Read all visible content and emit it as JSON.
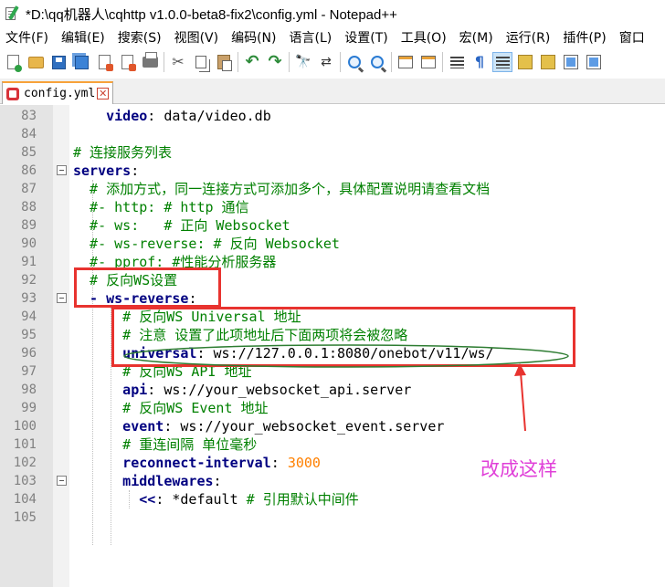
{
  "window": {
    "title": "*D:\\qq机器人\\cqhttp v1.0.0-beta8-fix2\\config.yml - Notepad++"
  },
  "menu": [
    "文件(F)",
    "编辑(E)",
    "搜索(S)",
    "视图(V)",
    "编码(N)",
    "语言(L)",
    "设置(T)",
    "工具(O)",
    "宏(M)",
    "运行(R)",
    "插件(P)",
    "窗口"
  ],
  "toolbar": {
    "icons": [
      "new-file",
      "open-file",
      "save",
      "save-all",
      "close",
      "close-all",
      "print",
      "cut",
      "copy",
      "paste",
      "undo",
      "redo",
      "find",
      "replace",
      "zoom-in",
      "zoom-out",
      "sync-vertical",
      "sync-horizontal",
      "word-wrap",
      "show-all-chars",
      "indent-guide",
      "doc-map",
      "function-list",
      "folder-workspace",
      "monitor"
    ]
  },
  "tab": {
    "label": "config.yml",
    "close": "✕"
  },
  "editor": {
    "lines": [
      {
        "n": "83",
        "segs": [
          [
            "k",
            "    video"
          ],
          [
            "v",
            ": data/video.db"
          ]
        ]
      },
      {
        "n": "84",
        "segs": []
      },
      {
        "n": "85",
        "segs": [
          [
            "c",
            "# 连接服务列表"
          ]
        ]
      },
      {
        "n": "86",
        "segs": [
          [
            "k",
            "servers"
          ],
          [
            "v",
            ":"
          ]
        ],
        "fold": true
      },
      {
        "n": "87",
        "segs": [
          [
            "c",
            "  # 添加方式，同一连接方式可添加多个，具体配置说明请查看文档"
          ]
        ]
      },
      {
        "n": "88",
        "segs": [
          [
            "c",
            "  #- http: # http 通信"
          ]
        ]
      },
      {
        "n": "89",
        "segs": [
          [
            "c",
            "  #- ws:   # 正向 Websocket"
          ]
        ]
      },
      {
        "n": "90",
        "segs": [
          [
            "c",
            "  #- ws-reverse: # 反向 Websocket"
          ]
        ]
      },
      {
        "n": "91",
        "segs": [
          [
            "c",
            "  #- pprof: #性能分析服务器"
          ]
        ]
      },
      {
        "n": "92",
        "segs": [
          [
            "c",
            "  # 反向WS设置"
          ]
        ]
      },
      {
        "n": "93",
        "segs": [
          [
            "k",
            "  - ws-reverse"
          ],
          [
            "v",
            ":"
          ]
        ],
        "fold": true
      },
      {
        "n": "94",
        "segs": [
          [
            "c",
            "      # 反向WS Universal 地址"
          ]
        ]
      },
      {
        "n": "95",
        "segs": [
          [
            "c",
            "      # 注意 设置了此项地址后下面两项将会被忽略"
          ]
        ]
      },
      {
        "n": "96",
        "segs": [
          [
            "k",
            "      universal"
          ],
          [
            "v",
            ": ws://127.0.0.1:8080/onebot/v11/ws/"
          ]
        ]
      },
      {
        "n": "97",
        "segs": [
          [
            "c",
            "      # 反向WS API 地址"
          ]
        ]
      },
      {
        "n": "98",
        "segs": [
          [
            "k",
            "      api"
          ],
          [
            "v",
            ": ws://your_websocket_api.server"
          ]
        ]
      },
      {
        "n": "99",
        "segs": [
          [
            "c",
            "      # 反向WS Event 地址"
          ]
        ]
      },
      {
        "n": "100",
        "segs": [
          [
            "k",
            "      event"
          ],
          [
            "v",
            ": ws://your_websocket_event.server"
          ]
        ]
      },
      {
        "n": "101",
        "segs": [
          [
            "c",
            "      # 重连间隔 单位毫秒"
          ]
        ]
      },
      {
        "n": "102",
        "segs": [
          [
            "k",
            "      reconnect-interval"
          ],
          [
            "v",
            ": "
          ],
          [
            "n",
            "3000"
          ]
        ]
      },
      {
        "n": "103",
        "segs": [
          [
            "k",
            "      middlewares"
          ],
          [
            "v",
            ":"
          ]
        ],
        "fold": true
      },
      {
        "n": "104",
        "segs": [
          [
            "k",
            "        <<"
          ],
          [
            "v",
            ": *default "
          ],
          [
            "c",
            "# 引用默认中间件"
          ]
        ]
      },
      {
        "n": "105",
        "segs": []
      }
    ]
  },
  "annotation": {
    "note": "改成这样",
    "color": "#e8332f",
    "note_color": "#e040d8",
    "ellipse_color": "#2e7d32"
  }
}
